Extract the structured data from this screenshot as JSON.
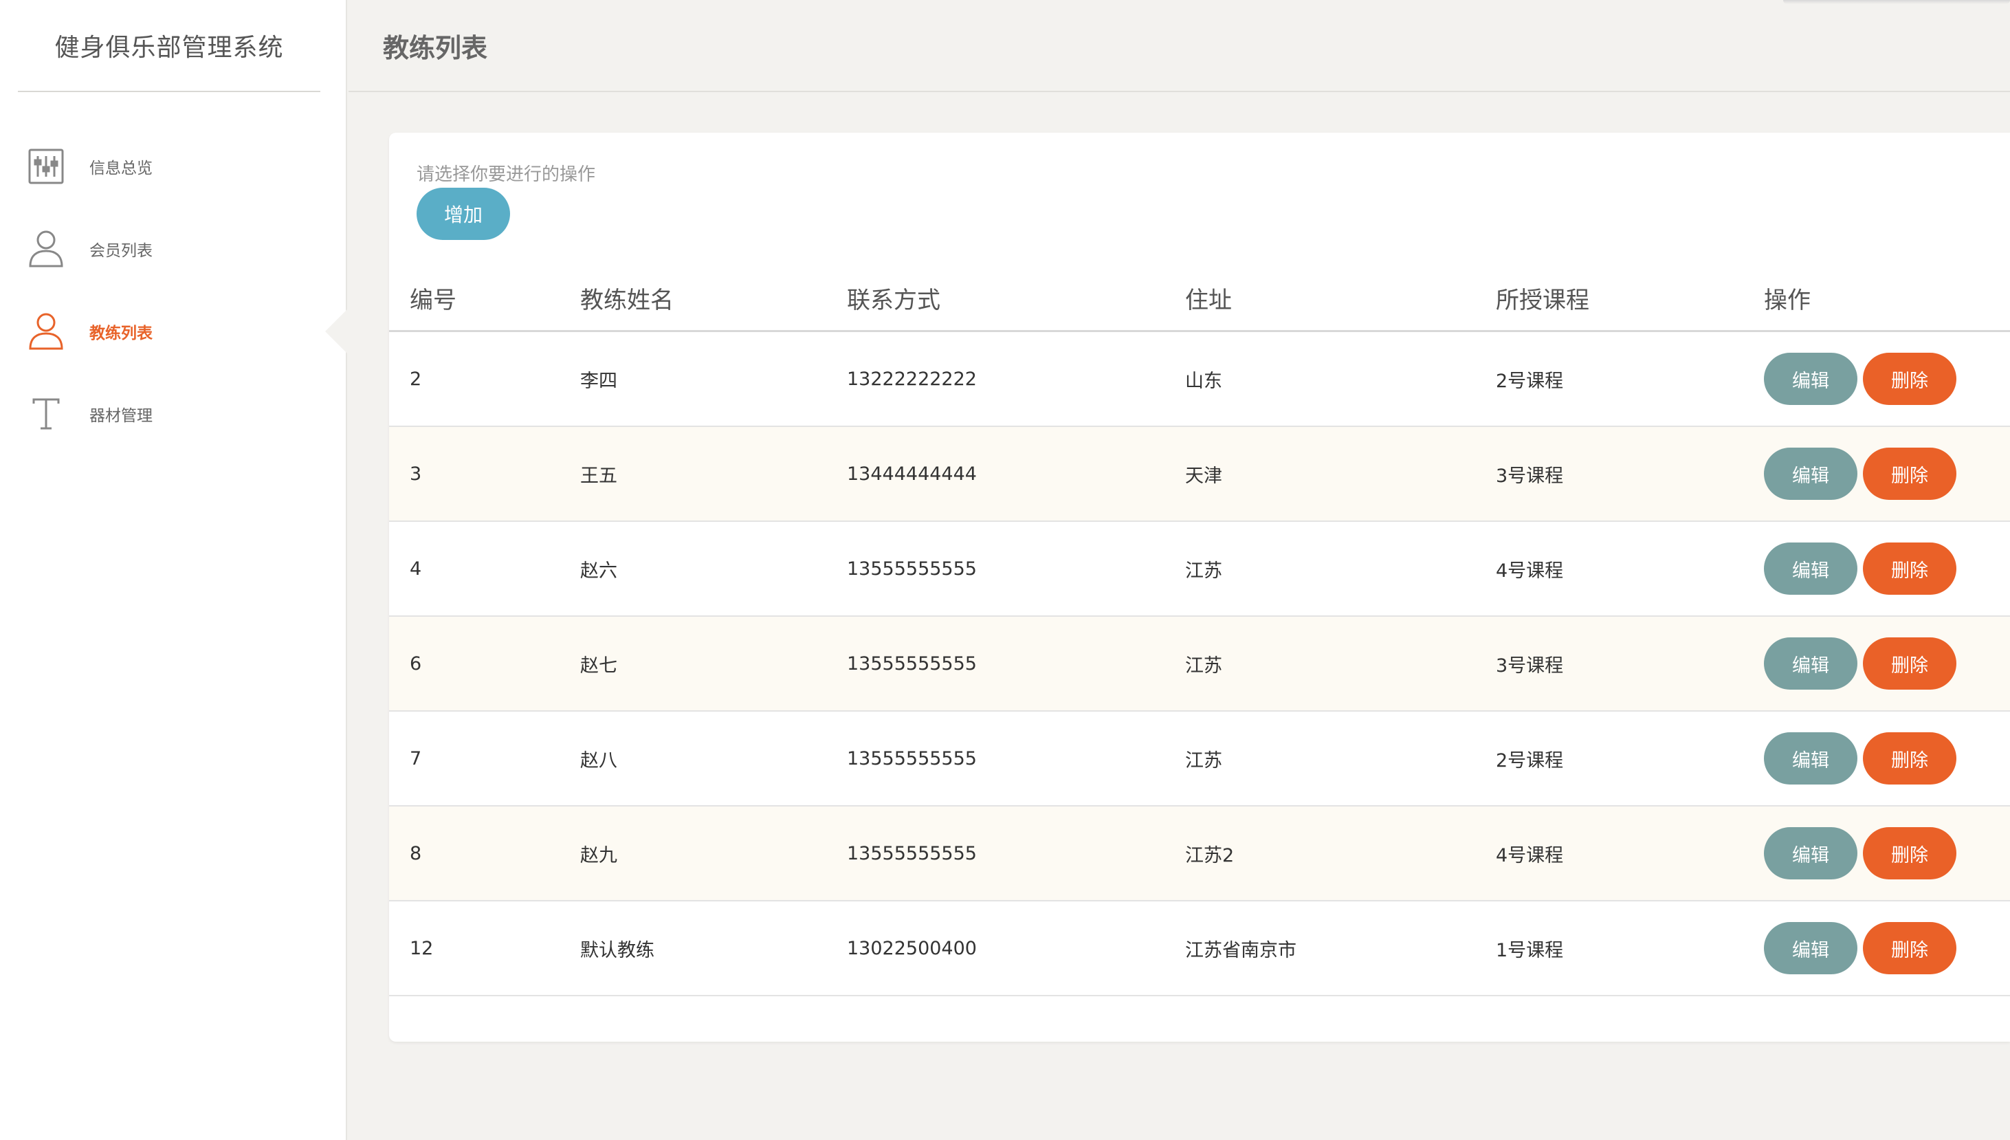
{
  "app": {
    "title": "健身俱乐部管理系统"
  },
  "nav": [
    {
      "label": "信息总览",
      "icon": "sliders-icon"
    },
    {
      "label": "会员列表",
      "icon": "user-icon"
    },
    {
      "label": "教练列表",
      "icon": "user-icon",
      "active": true
    },
    {
      "label": "器材管理",
      "icon": "text-t-icon"
    }
  ],
  "header": {
    "title": "教练列表"
  },
  "toolbar": {
    "prompt": "请选择你要进行的操作",
    "add_label": "增加"
  },
  "table": {
    "columns": [
      "编号",
      "教练姓名",
      "联系方式",
      "住址",
      "所授课程",
      "操作"
    ],
    "edit_label": "编辑",
    "delete_label": "删除",
    "rows": [
      {
        "id": "2",
        "name": "李四",
        "phone": "13222222222",
        "address": "山东",
        "course": "2号课程"
      },
      {
        "id": "3",
        "name": "王五",
        "phone": "13444444444",
        "address": "天津",
        "course": "3号课程"
      },
      {
        "id": "4",
        "name": "赵六",
        "phone": "13555555555",
        "address": "江苏",
        "course": "4号课程"
      },
      {
        "id": "6",
        "name": "赵七",
        "phone": "13555555555",
        "address": "江苏",
        "course": "3号课程"
      },
      {
        "id": "7",
        "name": "赵八",
        "phone": "13555555555",
        "address": "江苏",
        "course": "2号课程"
      },
      {
        "id": "8",
        "name": "赵九",
        "phone": "13555555555",
        "address": "江苏2",
        "course": "4号课程"
      },
      {
        "id": "12",
        "name": "默认教练",
        "phone": "13022500400",
        "address": "江苏省南京市",
        "course": "1号课程"
      }
    ]
  },
  "colors": {
    "accent": "#e8632a",
    "add_button": "#5aaec7",
    "edit_button": "#79a0a0",
    "delete_button": "#ea6128"
  }
}
